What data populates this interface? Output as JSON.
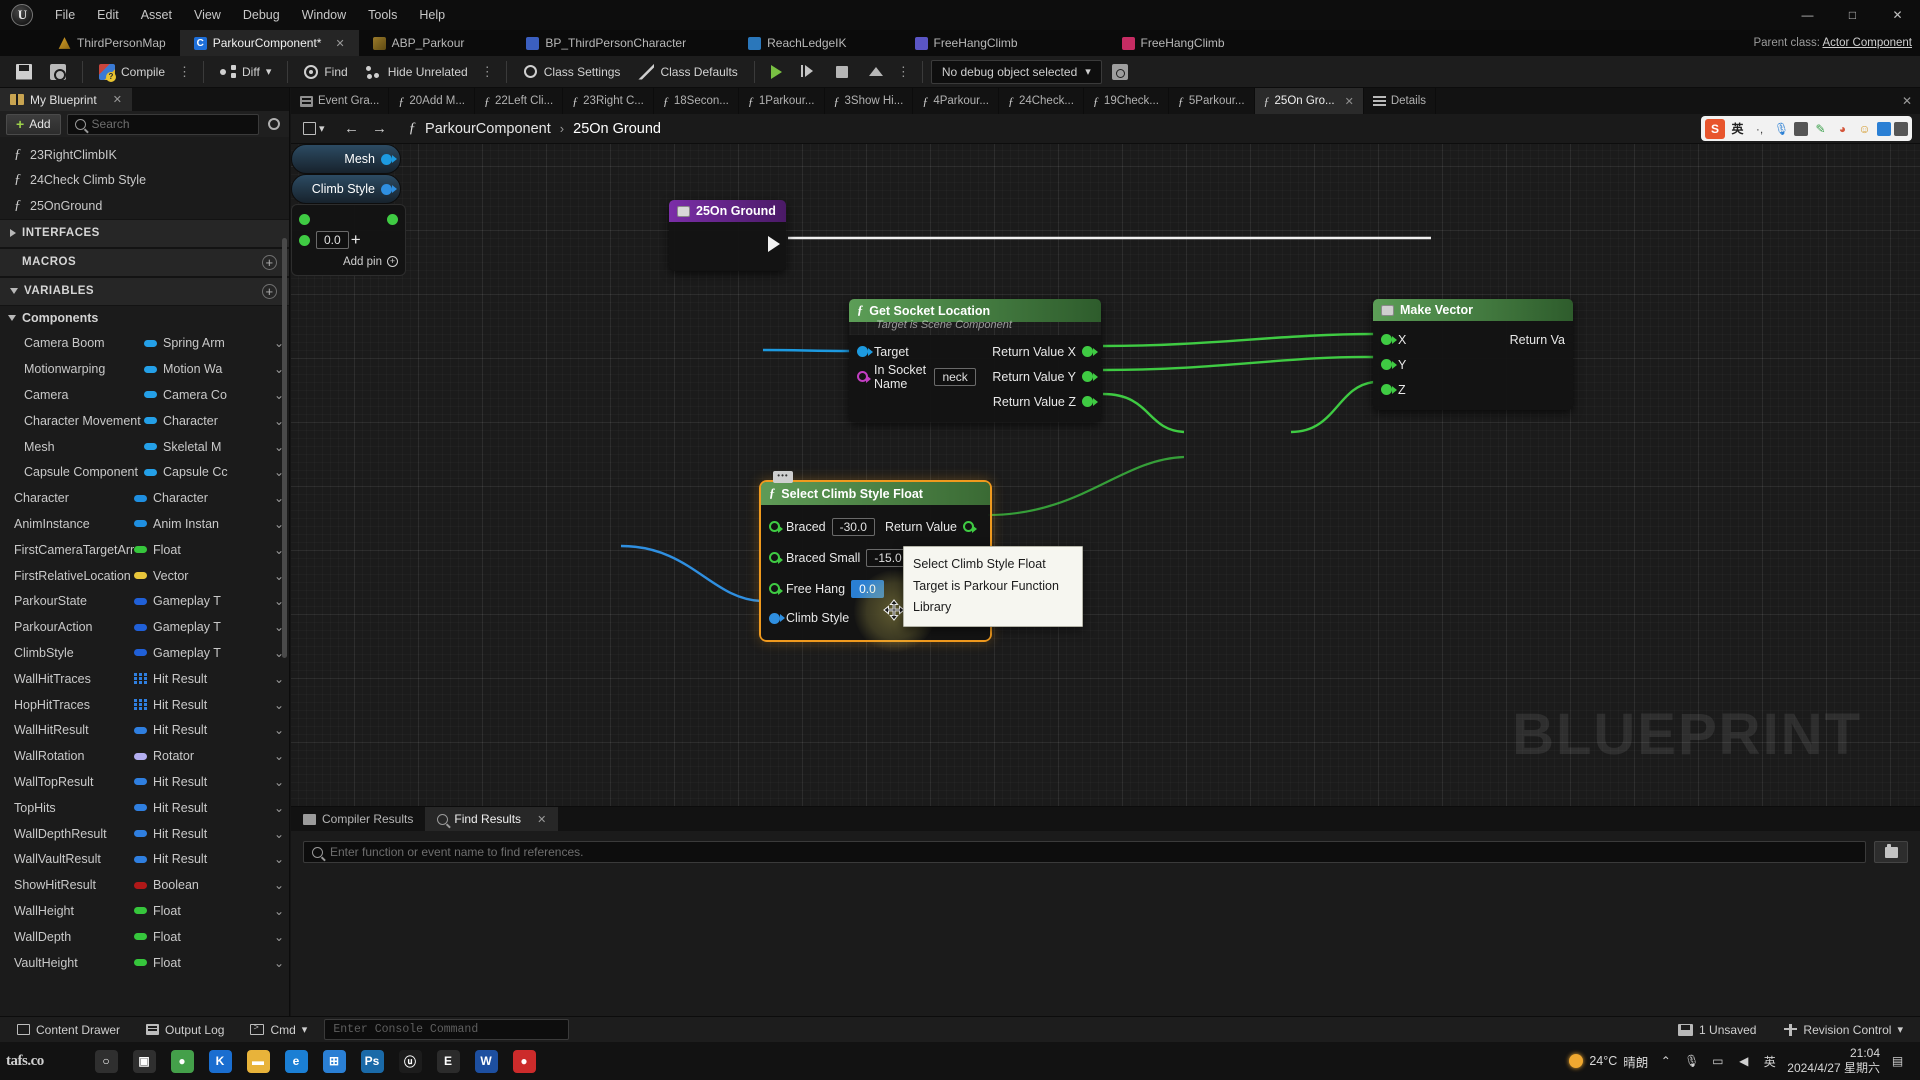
{
  "app": {
    "logo": "unreal-logo",
    "menu": [
      "File",
      "Edit",
      "Asset",
      "View",
      "Debug",
      "Window",
      "Tools",
      "Help"
    ],
    "window_controls": {
      "minimize": "—",
      "maximize": "□",
      "close": "✕"
    }
  },
  "asset_tabs": [
    {
      "label": "ThirdPersonMap",
      "icon": "map-icon",
      "active": false,
      "closable": false
    },
    {
      "label": "ParkourComponent*",
      "icon": "blueprint-icon",
      "active": true,
      "closable": true
    },
    {
      "label": "ABP_Parkour",
      "icon": "anim-blueprint-icon",
      "active": false,
      "closable": false
    },
    {
      "label": "BP_ThirdPersonCharacter",
      "icon": "character-icon",
      "active": false,
      "closable": false
    },
    {
      "label": "ReachLedgeIK",
      "icon": "ik-icon",
      "active": false,
      "closable": false
    },
    {
      "label": "FreeHangClimb",
      "icon": "anim-sequence-icon",
      "active": false,
      "closable": false
    },
    {
      "label": "FreeHangClimb",
      "icon": "anim-montage-icon",
      "active": false,
      "closable": false
    }
  ],
  "parent_class": {
    "label": "Parent class:",
    "value": "Actor Component"
  },
  "toolbar": {
    "save": "",
    "browse": "",
    "compile": "Compile",
    "diff": "Diff",
    "find": "Find",
    "hide_unrelated": "Hide Unrelated",
    "class_settings": "Class Settings",
    "class_defaults": "Class Defaults",
    "debug_object": "No debug object selected",
    "play": "play-button",
    "step": "step-button",
    "stop": "stop-button",
    "eject": "eject-button"
  },
  "my_blueprint": {
    "panel_title": "My Blueprint",
    "add_label": "Add",
    "search_placeholder": "Search",
    "functions": [
      {
        "label": "23RightClimbIK"
      },
      {
        "label": "24Check Climb Style"
      },
      {
        "label": "25OnGround"
      }
    ],
    "sections": [
      {
        "label": "INTERFACES",
        "expanded": false,
        "has_add": false
      },
      {
        "label": "MACROS",
        "expanded": false,
        "has_add": true
      },
      {
        "label": "VARIABLES",
        "expanded": true,
        "has_add": true
      }
    ],
    "components_label": "Components",
    "components": [
      {
        "name": "Camera Boom",
        "type": "Spring Arm",
        "pin": "#24a0e8"
      },
      {
        "name": "Motionwarping",
        "type": "Motion Wa",
        "pin": "#24a0e8"
      },
      {
        "name": "Camera",
        "type": "Camera Co",
        "pin": "#24a0e8"
      },
      {
        "name": "Character Movement",
        "type": "Character",
        "pin": "#24a0e8"
      },
      {
        "name": "Mesh",
        "type": "Skeletal M",
        "pin": "#24a0e8"
      },
      {
        "name": "Capsule Component",
        "type": "Capsule Cc",
        "pin": "#24a0e8"
      }
    ],
    "variables": [
      {
        "name": "Character",
        "type": "Character",
        "pin": "#1f8fe0",
        "kind": "pill"
      },
      {
        "name": "AnimInstance",
        "type": "Anim Instan",
        "pin": "#1f8fe0",
        "kind": "pill"
      },
      {
        "name": "FirstCameraTargetArm",
        "type": "Float",
        "pin": "#36c63c",
        "kind": "pill"
      },
      {
        "name": "FirstRelativeLocation",
        "type": "Vector",
        "pin": "#e8c53a",
        "kind": "pill"
      },
      {
        "name": "ParkourState",
        "type": "Gameplay T",
        "pin": "#2060d8",
        "kind": "pill"
      },
      {
        "name": "ParkourAction",
        "type": "Gameplay T",
        "pin": "#2060d8",
        "kind": "pill"
      },
      {
        "name": "ClimbStyle",
        "type": "Gameplay T",
        "pin": "#2060d8",
        "kind": "pill"
      },
      {
        "name": "WallHitTraces",
        "type": "Hit Result",
        "pin": "#2f7fe0",
        "kind": "grid"
      },
      {
        "name": "HopHitTraces",
        "type": "Hit Result",
        "pin": "#2f7fe0",
        "kind": "grid"
      },
      {
        "name": "WallHitResult",
        "type": "Hit Result",
        "pin": "#2f7fe0",
        "kind": "pill"
      },
      {
        "name": "WallRotation",
        "type": "Rotator",
        "pin": "#b3aef0",
        "kind": "pill"
      },
      {
        "name": "WallTopResult",
        "type": "Hit Result",
        "pin": "#2f7fe0",
        "kind": "pill"
      },
      {
        "name": "TopHits",
        "type": "Hit Result",
        "pin": "#2f7fe0",
        "kind": "pill"
      },
      {
        "name": "WallDepthResult",
        "type": "Hit Result",
        "pin": "#2f7fe0",
        "kind": "pill"
      },
      {
        "name": "WallVaultResult",
        "type": "Hit Result",
        "pin": "#2f7fe0",
        "kind": "pill"
      },
      {
        "name": "ShowHitResult",
        "type": "Boolean",
        "pin": "#b01818",
        "kind": "pill"
      },
      {
        "name": "WallHeight",
        "type": "Float",
        "pin": "#36c63c",
        "kind": "pill"
      },
      {
        "name": "WallDepth",
        "type": "Float",
        "pin": "#36c63c",
        "kind": "pill"
      },
      {
        "name": "VaultHeight",
        "type": "Float",
        "pin": "#36c63c",
        "kind": "pill"
      }
    ]
  },
  "graph_tabs": [
    {
      "label": "Event Gra...",
      "icon": "event-graph-icon",
      "active": false
    },
    {
      "label": "20Add M...",
      "icon": "function-icon",
      "active": false
    },
    {
      "label": "22Left Cli...",
      "icon": "function-icon",
      "active": false
    },
    {
      "label": "23Right C...",
      "icon": "function-icon",
      "active": false
    },
    {
      "label": "18Secon...",
      "icon": "function-icon",
      "active": false
    },
    {
      "label": "1Parkour...",
      "icon": "function-icon",
      "active": false
    },
    {
      "label": "3Show Hi...",
      "icon": "function-icon",
      "active": false
    },
    {
      "label": "4Parkour...",
      "icon": "function-icon",
      "active": false
    },
    {
      "label": "24Check...",
      "icon": "function-icon",
      "active": false
    },
    {
      "label": "19Check...",
      "icon": "function-icon",
      "active": false
    },
    {
      "label": "5Parkour...",
      "icon": "function-icon",
      "active": false
    },
    {
      "label": "25On Gro...",
      "icon": "function-icon",
      "active": true,
      "closable": true
    },
    {
      "label": "Details",
      "icon": "details-icon",
      "active": false
    }
  ],
  "breadcrumb": {
    "root": "ParkourComponent",
    "separator": "›",
    "current": "25On Ground"
  },
  "ime_toolbar": {
    "brand": "S",
    "items": [
      "英",
      "·,",
      "mic-icon",
      "keyboard-icon",
      "pen-icon",
      "palette-icon",
      "smiley-icon",
      "grid-icon",
      "gear-icon"
    ]
  },
  "graph": {
    "watermark": "BLUEPRINT",
    "nodes": [
      {
        "id": "event-25onground",
        "title": "25On Ground",
        "type": "event",
        "outputs": [
          "exec"
        ]
      },
      {
        "id": "mesh-getter",
        "title": "Mesh",
        "type": "variable-getter"
      },
      {
        "id": "climbstyle-getter",
        "title": "Climb Style",
        "type": "variable-getter"
      },
      {
        "id": "get-socket-location",
        "title": "Get Socket Location",
        "subtitle": "Target is Scene Component",
        "type": "function",
        "inputs": [
          {
            "label": "Target",
            "pin": "object"
          },
          {
            "label": "In Socket Name",
            "pin": "name",
            "value": "neck"
          }
        ],
        "outputs": [
          {
            "label": "Return Value X",
            "pin": "float"
          },
          {
            "label": "Return Value Y",
            "pin": "float"
          },
          {
            "label": "Return Value Z",
            "pin": "float"
          }
        ]
      },
      {
        "id": "make-vector",
        "title": "Make Vector",
        "type": "function",
        "inputs": [
          {
            "label": "X",
            "pin": "float"
          },
          {
            "label": "Y",
            "pin": "float"
          },
          {
            "label": "Z",
            "pin": "float"
          }
        ],
        "outputs": [
          {
            "label": "Return Va",
            "pin": "vector"
          }
        ]
      },
      {
        "id": "add-float",
        "title": "+",
        "type": "math",
        "value": "0.0",
        "add_pin_label": "Add pin"
      },
      {
        "id": "select-climb-style-float",
        "title": "Select Climb Style Float",
        "type": "function",
        "selected": true,
        "inputs": [
          {
            "label": "Braced",
            "pin": "float",
            "value": "-30.0"
          },
          {
            "label": "Braced Small",
            "pin": "float",
            "value": "-15.0"
          },
          {
            "label": "Free Hang",
            "pin": "float",
            "value": "0.0",
            "value_selected": true
          },
          {
            "label": "Climb Style",
            "pin": "struct"
          }
        ],
        "outputs": [
          {
            "label": "Return Value",
            "pin": "float"
          }
        ]
      }
    ],
    "tooltip": {
      "title": "Select Climb Style Float",
      "subtitle": "Target is Parkour Function Library"
    }
  },
  "bottom_dock": {
    "tabs": [
      {
        "label": "Compiler Results",
        "icon": "compiler-icon",
        "active": false
      },
      {
        "label": "Find Results",
        "icon": "search-icon",
        "active": true,
        "closable": true
      }
    ],
    "find_placeholder": "Enter function or event name to find references."
  },
  "status_bar": {
    "content_drawer": "Content Drawer",
    "output_log": "Output Log",
    "cmd_label": "Cmd",
    "cmd_placeholder": "Enter Console Command",
    "unsaved": "1 Unsaved",
    "revision_control": "Revision Control"
  },
  "taskbar": {
    "brand": "tafs.co",
    "apps": [
      {
        "name": "search-icon",
        "color": "#2f2f2f",
        "glyph": "○"
      },
      {
        "name": "task-view-icon",
        "color": "#2f2f2f",
        "glyph": "▣"
      },
      {
        "name": "chrome-icon",
        "color": "#44a04a",
        "glyph": "●"
      },
      {
        "name": "kugou-icon",
        "color": "#1a6ed0",
        "glyph": "K"
      },
      {
        "name": "explorer-icon",
        "color": "#e8b33a",
        "glyph": "▬"
      },
      {
        "name": "edge-icon",
        "color": "#1b7fd4",
        "glyph": "e"
      },
      {
        "name": "store-icon",
        "color": "#2a7fd4",
        "glyph": "⊞"
      },
      {
        "name": "photoshop-icon",
        "color": "#1a6aa8",
        "glyph": "Ps"
      },
      {
        "name": "unreal-icon",
        "color": "#1c1c1c",
        "glyph": "ⓤ"
      },
      {
        "name": "epic-icon",
        "color": "#2b2b2b",
        "glyph": "E"
      },
      {
        "name": "word-icon",
        "color": "#1d4fa0",
        "glyph": "W"
      },
      {
        "name": "record-icon",
        "color": "#cc2b2b",
        "glyph": "●"
      }
    ],
    "weather": {
      "temp": "24°C",
      "desc": "晴朗"
    },
    "clock": {
      "time": "21:04",
      "date": "2024/4/27 星期六"
    },
    "tray": [
      "⌃",
      "音",
      "⚡",
      "全",
      "⌨",
      "✉"
    ]
  }
}
